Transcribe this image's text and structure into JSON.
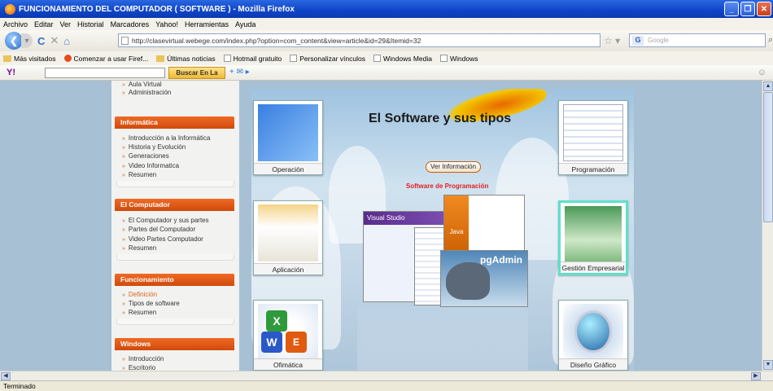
{
  "window": {
    "title": "FUNCIONAMIENTO DEL COMPUTADOR ( SOFTWARE ) - Mozilla Firefox"
  },
  "menu": [
    "Archivo",
    "Editar",
    "Ver",
    "Historial",
    "Marcadores",
    "Yahoo!",
    "Herramientas",
    "Ayuda"
  ],
  "nav": {
    "url": "http://clasevirtual.webege.com/index.php?option=com_content&view=article&id=29&Itemid=32",
    "search_placeholder": "Google",
    "back_glyph": "❮",
    "forward_glyph": "▾",
    "reload_glyph": "C",
    "stop_glyph": "✕",
    "home_glyph": "⌂"
  },
  "bookmarks": [
    "Más visitados",
    "Comenzar a usar Firef...",
    "Últimas noticias",
    "Hotmail gratuito",
    "Personalizar vínculos",
    "Windows Media",
    "Windows"
  ],
  "yahoo": {
    "logo": "Y!",
    "button": "Buscar En La Web"
  },
  "sidebar": {
    "top_items": [
      "Aula Virtual",
      "Administración"
    ],
    "informatica": {
      "title": "Informática",
      "items": [
        "Introducción a la Informática",
        "Historia y Evolución",
        "Generaciones",
        "Video Informatica",
        "Resumen"
      ]
    },
    "computador": {
      "title": "El Computador",
      "items": [
        "El Computador y sus partes",
        "Partes del Computador",
        "Video Partes Computador",
        "Resumen"
      ]
    },
    "funcionamiento": {
      "title": "Funcionamiento",
      "items": [
        "Definición",
        "Tipos de software",
        "Resumen"
      ]
    },
    "windows": {
      "title": "Windows",
      "items": [
        "Introducción",
        "Escritorio"
      ]
    }
  },
  "content": {
    "title": "El Software y sus tipos",
    "info_button": "Ver Información",
    "subtitle": "Software de Programación",
    "cards": [
      "Operación",
      "Programación",
      "Aplicación",
      "Gestión Empresarial",
      "Ofimática",
      "Diseño Gráfico"
    ],
    "stack_labels": {
      "vs": "Visual Studio",
      "java": "Java",
      "pgadmin": "pgAdmin"
    }
  },
  "status": "Terminado"
}
